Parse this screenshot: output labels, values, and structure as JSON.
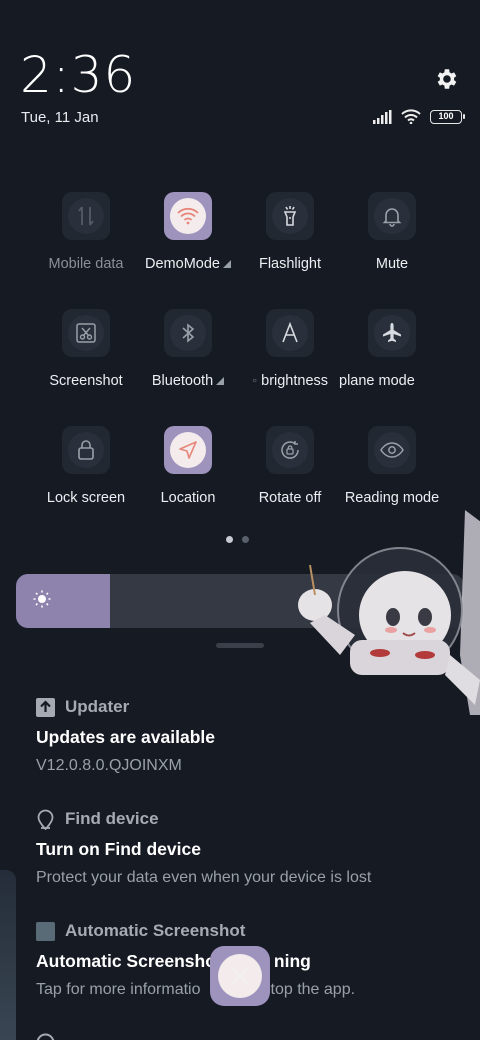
{
  "header": {
    "time": "2:36",
    "date": "Tue, 11 Jan",
    "battery": "100"
  },
  "tiles": [
    {
      "label": "Mobile data",
      "icon": "mobile-data-icon",
      "active": false,
      "dim": true
    },
    {
      "label": "DemoMode",
      "icon": "wifi-icon",
      "active": true,
      "expand": true
    },
    {
      "label": "Flashlight",
      "icon": "flashlight-icon",
      "active": false
    },
    {
      "label": "Mute",
      "icon": "bell-icon",
      "active": false
    },
    {
      "label": "Screenshot",
      "icon": "scissors-icon",
      "active": false
    },
    {
      "label": "Bluetooth",
      "icon": "bluetooth-icon",
      "active": false,
      "expand": true
    },
    {
      "label": "brightness",
      "icon": "auto-brightness-icon",
      "active": false
    },
    {
      "label": "plane mode",
      "icon": "airplane-icon",
      "active": false
    },
    {
      "label": "Lock screen",
      "icon": "lock-icon",
      "active": false
    },
    {
      "label": "Location",
      "icon": "location-icon",
      "active": true
    },
    {
      "label": "Rotate off",
      "icon": "rotate-lock-icon",
      "active": false
    },
    {
      "label": "Reading mode",
      "icon": "eye-icon",
      "active": false
    }
  ],
  "brightness": {
    "level": 0.21
  },
  "notifications": [
    {
      "app": "Updater",
      "title": "Updates are available",
      "text": "V12.0.8.0.QJOINXM"
    },
    {
      "app": "Find device",
      "title": "Turn on Find device",
      "text": "Protect your data even when your device is lost"
    },
    {
      "app": "Automatic Screenshot",
      "title": "Automatic Screensho",
      "title_tail": "ning",
      "text": "Tap for more informatio",
      "text_tail": "stop the app."
    }
  ],
  "colors": {
    "accent": "#9e93bd",
    "background": "#151a23"
  }
}
